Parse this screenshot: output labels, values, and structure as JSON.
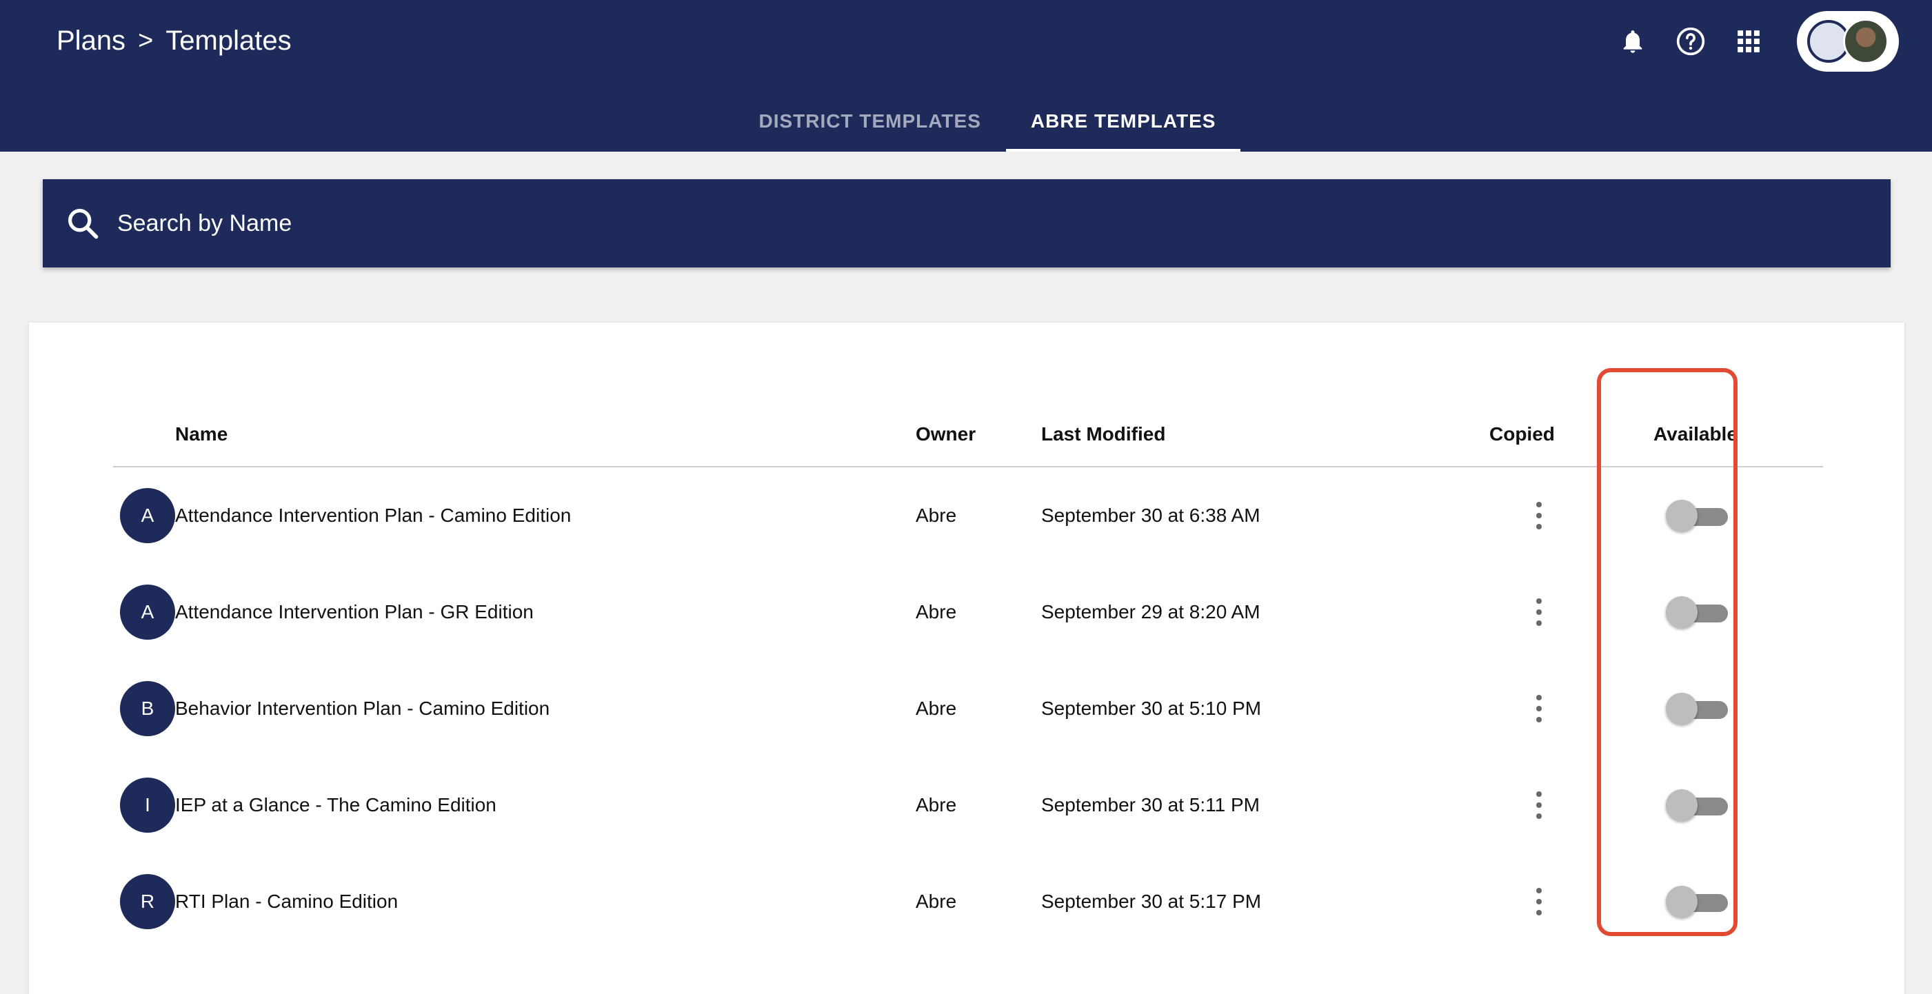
{
  "colors": {
    "navy": "#1e2a5a",
    "highlight": "#e34a33"
  },
  "breadcrumb": {
    "parent": "Plans",
    "separator": ">",
    "current": "Templates"
  },
  "header_icons": [
    "bell-icon",
    "help-icon",
    "apps-grid-icon"
  ],
  "tabs": [
    {
      "label": "DISTRICT TEMPLATES",
      "active": false
    },
    {
      "label": "ABRE TEMPLATES",
      "active": true
    }
  ],
  "search": {
    "placeholder": "Search by Name",
    "value": ""
  },
  "table": {
    "headers": {
      "name": "Name",
      "owner": "Owner",
      "last_modified": "Last Modified",
      "copied": "Copied",
      "available": "Available"
    },
    "rows": [
      {
        "letter": "A",
        "name": "Attendance Intervention Plan - Camino Edition",
        "owner": "Abre",
        "last_modified": "September 30 at 6:38 AM",
        "available": false
      },
      {
        "letter": "A",
        "name": "Attendance Intervention Plan - GR Edition",
        "owner": "Abre",
        "last_modified": "September 29 at 8:20 AM",
        "available": false
      },
      {
        "letter": "B",
        "name": "Behavior Intervention Plan - Camino Edition",
        "owner": "Abre",
        "last_modified": "September 30 at 5:10 PM",
        "available": false
      },
      {
        "letter": "I",
        "name": "IEP at a Glance - The Camino Edition",
        "owner": "Abre",
        "last_modified": "September 30 at 5:11 PM",
        "available": false
      },
      {
        "letter": "R",
        "name": "RTI Plan - Camino Edition",
        "owner": "Abre",
        "last_modified": "September 30 at 5:17 PM",
        "available": false
      }
    ]
  }
}
